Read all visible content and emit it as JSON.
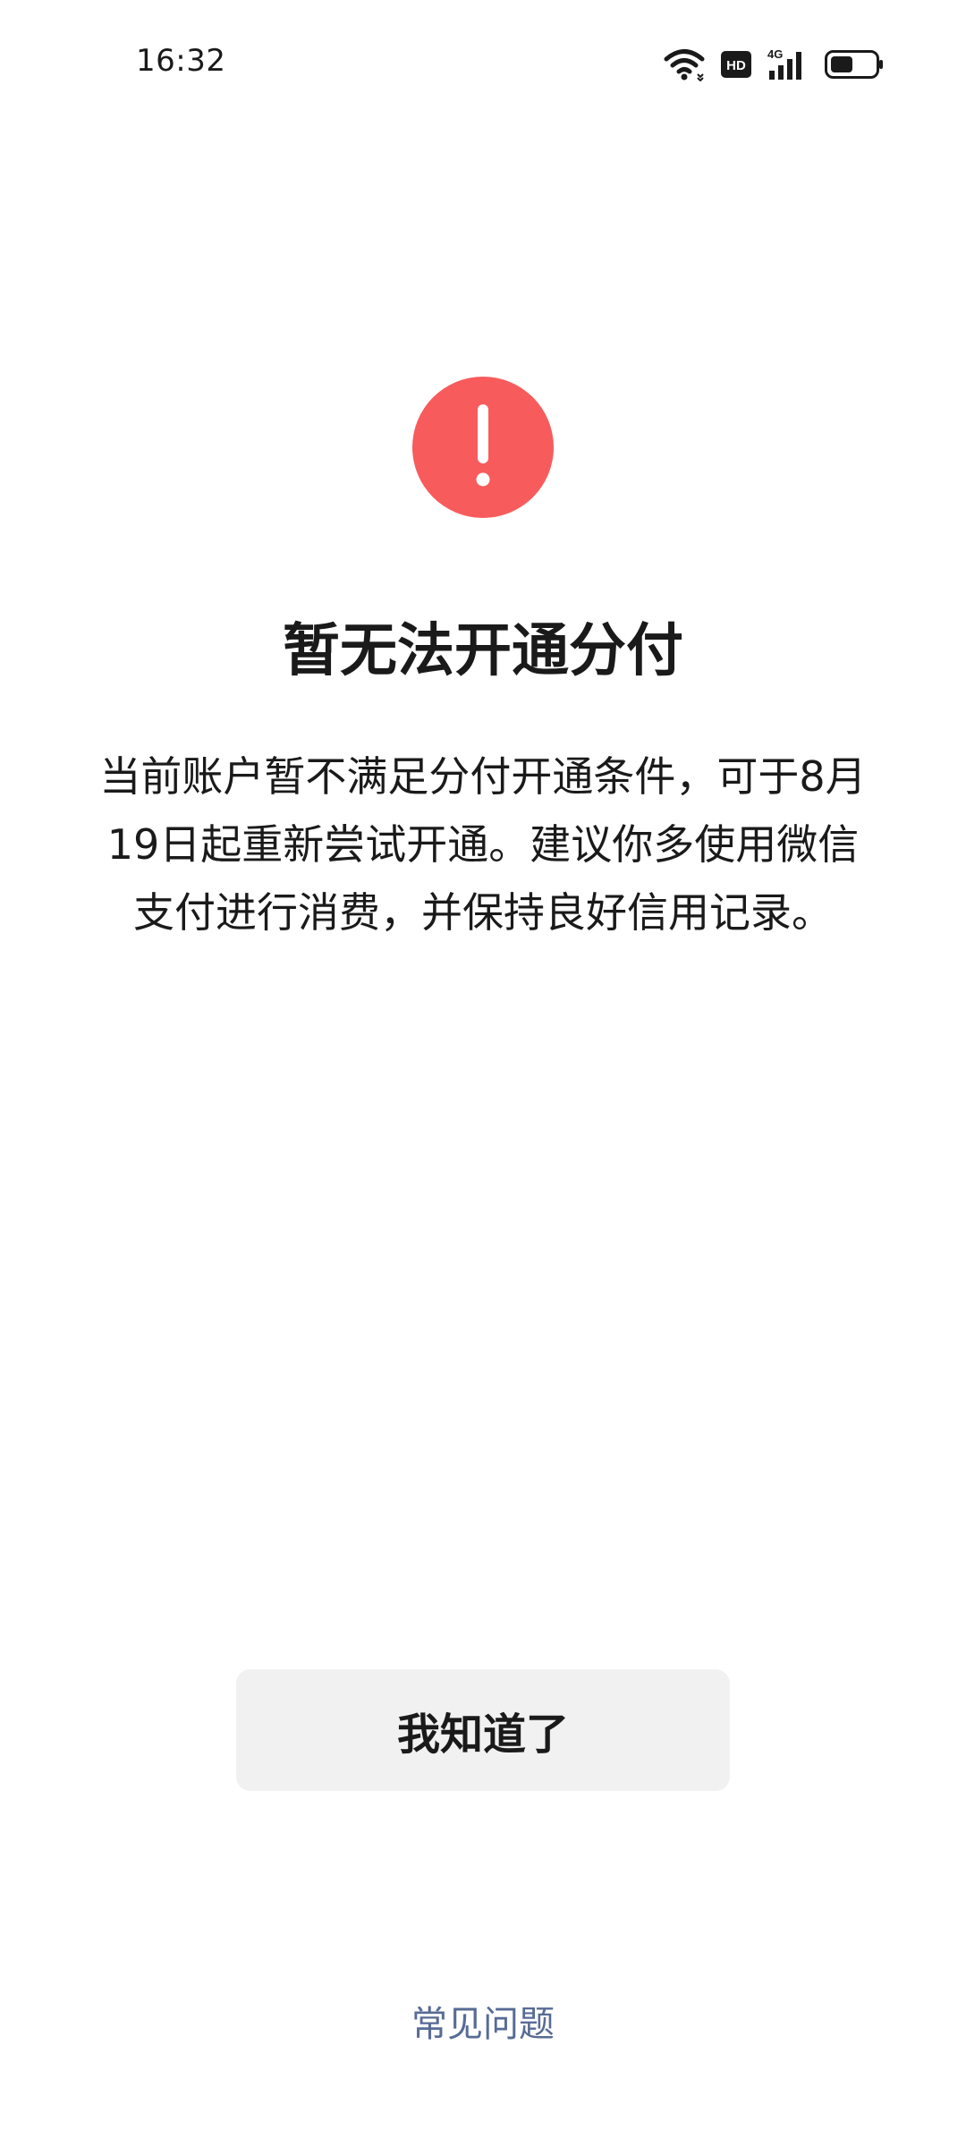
{
  "status_bar": {
    "time": "16:32",
    "icons": [
      "wifi-icon",
      "hd-icon",
      "4g-signal-icon",
      "battery-icon"
    ],
    "hd_label": "HD",
    "network_label": "4G"
  },
  "alert": {
    "icon": "exclamation-icon",
    "icon_color": "#f85b5c",
    "title": "暂无法开通分付",
    "message": "当前账户暂不满足分付开通条件，可于8月19日起重新尝试开通。建议你多使用微信支付进行消费，并保持良好信用记录。"
  },
  "actions": {
    "ack_label": "我知道了",
    "faq_label": "常见问题",
    "link_color": "#576b95"
  }
}
